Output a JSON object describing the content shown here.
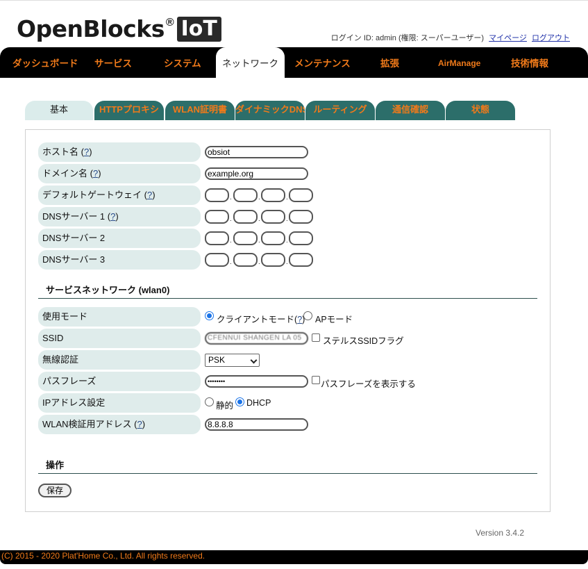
{
  "header": {
    "logo_text": "OpenBlocks",
    "logo_reg": "®",
    "logo_badge": "IoT",
    "login_text": "ログイン ID: admin (権限: スーパーユーザー)",
    "mypage_link": "マイページ",
    "logout_link": "ログアウト"
  },
  "mainnav": {
    "items": [
      {
        "label": "ダッシュボード"
      },
      {
        "label": "サービス"
      },
      {
        "label": "システム"
      },
      {
        "label": "ネットワーク"
      },
      {
        "label": "メンテナンス"
      },
      {
        "label": "拡張"
      },
      {
        "label": "AirManage"
      },
      {
        "label": "技術情報"
      }
    ],
    "active": "ネットワーク"
  },
  "subtabs": {
    "items": [
      {
        "label": "基本"
      },
      {
        "label": "HTTPプロキシ"
      },
      {
        "label": "WLAN証明書"
      },
      {
        "label": "ダイナミックDNS"
      },
      {
        "label": "ルーティング"
      },
      {
        "label": "通信確認"
      },
      {
        "label": "状態"
      }
    ],
    "active": "基本"
  },
  "basic": {
    "hostname": {
      "label": "ホスト名",
      "help": "?",
      "value": "obsiot"
    },
    "domain": {
      "label": "ドメイン名",
      "help": "?",
      "value": "example.org"
    },
    "gateway": {
      "label": "デフォルトゲートウェイ",
      "help": "?"
    },
    "dns1": {
      "label": "DNSサーバー 1",
      "help": "?"
    },
    "dns2": {
      "label": "DNSサーバー 2"
    },
    "dns3": {
      "label": "DNSサーバー 3"
    },
    "ip_separator": "."
  },
  "wlan": {
    "section_title": "サービスネットワーク (wlan0)",
    "mode": {
      "label": "使用モード",
      "client": "クライアントモード",
      "help": "?",
      "ap": "APモード",
      "selected": "client"
    },
    "ssid": {
      "label": "SSID",
      "value": "CFENNUI SHANGEN LA 05",
      "stealth": "ステルスSSIDフラグ"
    },
    "auth": {
      "label": "無線認証",
      "selected": "PSK"
    },
    "passphrase": {
      "label": "パスフレーズ",
      "value": "••••••••",
      "show": "パスフレーズを表示する"
    },
    "ipconf": {
      "label": "IPアドレス設定",
      "static": "静的",
      "dhcp": "DHCP",
      "selected": "dhcp"
    },
    "check_addr": {
      "label": "WLAN検証用アドレス",
      "help": "?",
      "value": "8.8.8.8"
    }
  },
  "operations": {
    "section_title": "操作",
    "save_label": "保存"
  },
  "version": "Version 3.4.2",
  "footer": "(C) 2015 - 2020 Plat'Home Co., Ltd. All rights reserved."
}
